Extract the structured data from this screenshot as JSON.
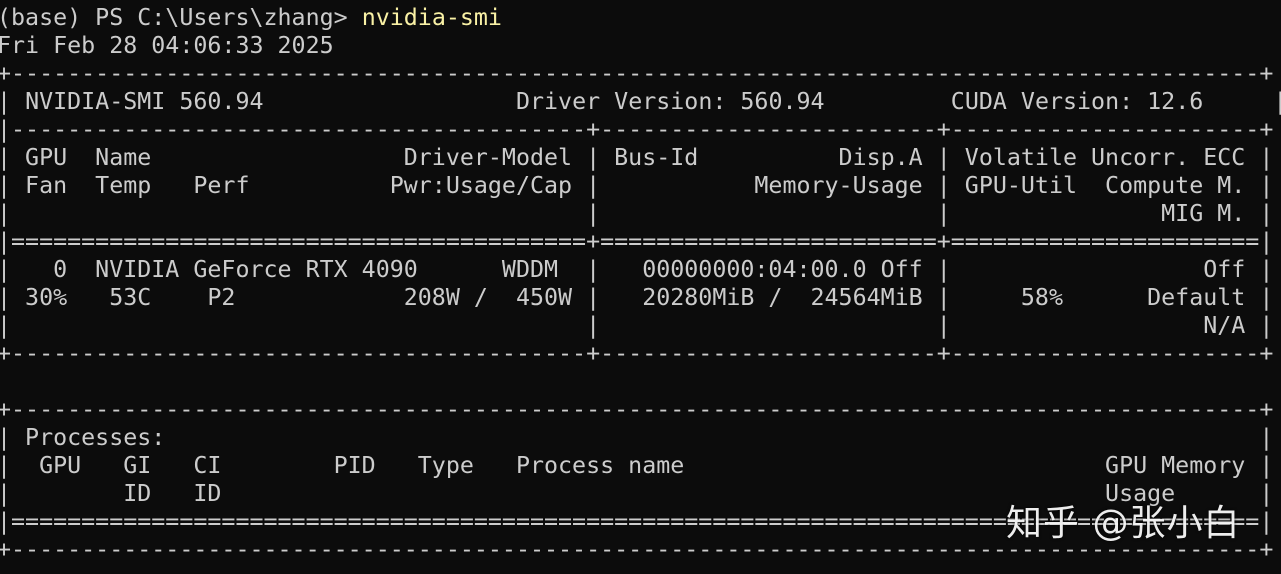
{
  "prompt": {
    "text": "(base) PS C:\\Users\\zhang> ",
    "command": "nvidia-smi"
  },
  "timestamp": "Fri Feb 28 04:06:33 2025",
  "header": {
    "smi_version": "NVIDIA-SMI 560.94",
    "driver_version": "Driver Version: 560.94",
    "cuda_version": "CUDA Version: 12.6"
  },
  "gpu_table": {
    "border_top": "+-----------------------------------------------------------------------------------------+",
    "header_row_border": "|-----------------------------------------+------------------------+----------------------+",
    "header_lines": [
      "| GPU  Name                  Driver-Model | Bus-Id          Disp.A | Volatile Uncorr. ECC |",
      "| Fan  Temp   Perf          Pwr:Usage/Cap |           Memory-Usage | GPU-Util  Compute M. |",
      "|                                         |                        |               MIG M. |"
    ],
    "double_border": "|=========================================+========================+======================|",
    "gpu_lines": [
      "|   0  NVIDIA GeForce RTX 4090      WDDM  |   00000000:04:00.0 Off |                  Off |",
      "| 30%   53C    P2            208W /  450W |   20280MiB /  24564MiB |     58%      Default |",
      "|                                         |                        |                  N/A |"
    ],
    "border_bottom": "+-----------------------------------------+------------------------+----------------------+"
  },
  "processes": {
    "border_top": "+-----------------------------------------------------------------------------------------+",
    "title": "| Processes:                                                                              |",
    "header_lines": [
      "|  GPU   GI   CI        PID   Type   Process name                              GPU Memory |",
      "|        ID   ID                                                               Usage      |"
    ],
    "double_border": "|=========================================================================================|",
    "border_bottom": "+-----------------------------------------------------------------------------------------+"
  },
  "watermark": "知乎 @张小白"
}
